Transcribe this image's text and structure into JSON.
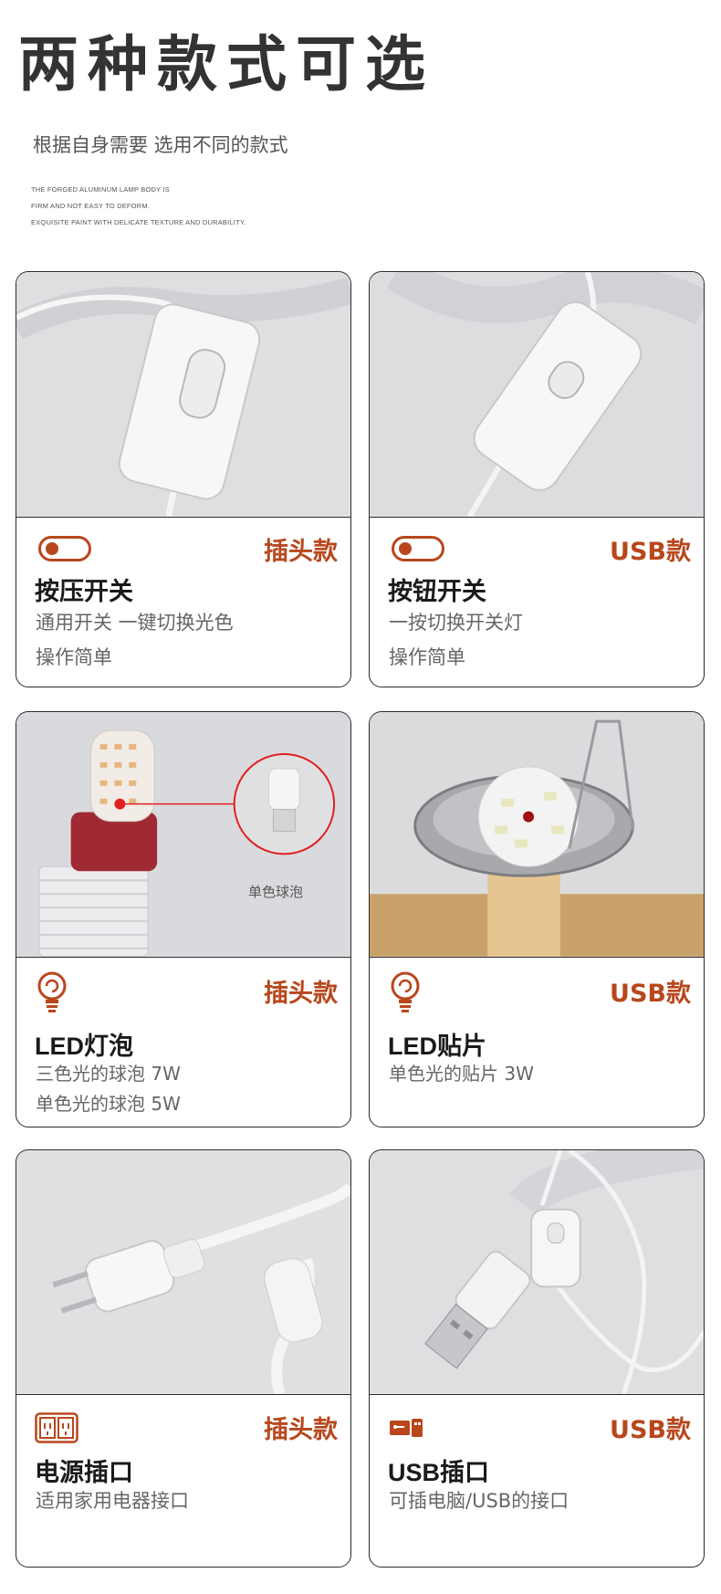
{
  "header": {
    "title": "两种款式可选",
    "subtitle": "根据自身需要 选用不同的款式",
    "en_lines": [
      "THE FORGED ALUMINUM LAMP BODY IS",
      "FIRM AND NOT EASY TO DEFORM.",
      "EXQUISITE PAINT WITH DELICATE TEXTURE AND DURABILITY."
    ]
  },
  "cards": [
    {
      "type": "插头款",
      "icon": "toggle-switch-icon",
      "title": "按压开关",
      "lines": [
        "通用开关 一键切换光色",
        "操作简单"
      ]
    },
    {
      "type": "USB款",
      "icon": "toggle-switch-icon",
      "title": "按钮开关",
      "lines": [
        "一按切换开关灯",
        "操作简单"
      ]
    },
    {
      "type": "插头款",
      "icon": "lightbulb-icon",
      "title": "LED灯泡",
      "lines": [
        "三色光的球泡 7W",
        "单色光的球泡 5W"
      ],
      "callout": "单色球泡"
    },
    {
      "type": "USB款",
      "icon": "lightbulb-icon",
      "title": "LED贴片",
      "lines": [
        "单色光的贴片 3W"
      ]
    },
    {
      "type": "插头款",
      "icon": "power-socket-icon",
      "title": "电源插口",
      "lines": [
        "适用家用电器接口"
      ]
    },
    {
      "type": "USB款",
      "icon": "usb-icon",
      "title": "USB插口",
      "lines": [
        "可插电脑/USB的接口"
      ]
    }
  ],
  "colors": {
    "accent": "#b8471d",
    "border": "#2a2a2a",
    "photo_bg": "#e4e4e6"
  }
}
